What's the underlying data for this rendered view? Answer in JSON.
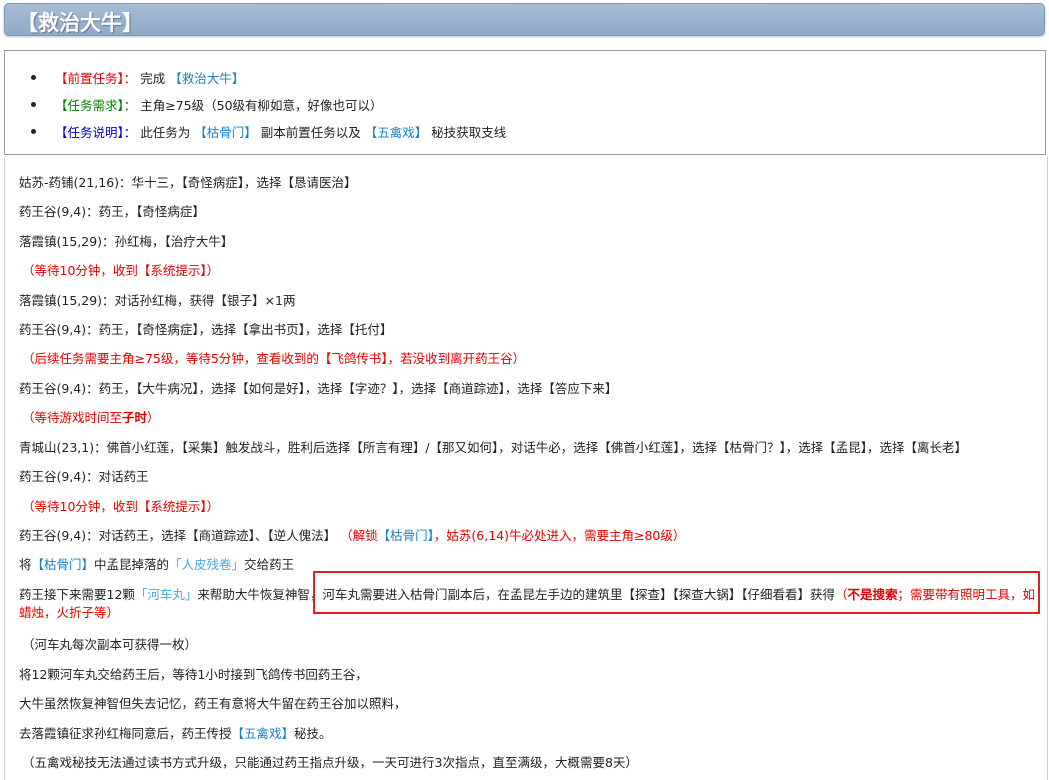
{
  "header": {
    "title": "【救治大牛】"
  },
  "info": {
    "pre_label": "【前置任务】：",
    "pre_text": "完成",
    "pre_link": "【救治大牛】",
    "req_label": "【任务需求】：",
    "req_text": "主角≥75级（50级有柳如意，好像也可以）",
    "desc_label": "【任务说明】：",
    "desc_text1": "此任务为",
    "desc_link1": "【枯骨门】",
    "desc_text2": "副本前置任务以及",
    "desc_link2": "【五禽戏】",
    "desc_text3": "秘技获取支线"
  },
  "steps": {
    "s1": "姑苏-药铺(21,16)：华十三，【奇怪病症】，选择【恳请医治】",
    "s2": "药王谷(9,4)：药王，【奇怪病症】",
    "s3": "落霞镇(15,29)：孙红梅，【治疗大牛】",
    "n1": "（等待10分钟，收到【系统提示】）",
    "s4": "落霞镇(15,29)：对话孙红梅，获得【银子】×1两",
    "s5": "药王谷(9,4)：药王，【奇怪病症】，选择【拿出书页】，选择【托付】",
    "n2a": "（后续任务需要主角≥75级，等待5分钟，查看收到的",
    "n2b": "【飞鸽传书】",
    "n2c": "，若没收到离开药王谷）",
    "s6": "药王谷(9,4)：药王，【大牛病况】，选择【如何是好】，选择【字迹？】，选择【商道踪迹】，选择【答应下来】",
    "n3a": "（等待游戏时间至",
    "n3b": "子时",
    "n3c": "）",
    "s7": "青城山(23,1)：佛首小红莲，【采集】触发战斗，胜利后选择【所言有理】/【那又如何】，对话牛必，选择【佛首小红莲】，选择【枯骨门？】，选择【孟昆】，选择【离长老】",
    "s8": "药王谷(9,4)：对话药王",
    "n4": "（等待10分钟，收到【系统提示】）",
    "s9": "药王谷(9,4)：对话药王，选择【商道踪迹】、【逆人傀法】",
    "n5a": "（解锁",
    "n5b": "【枯骨门】",
    "n5c": "，姑苏(6,14)牛必处进入，需要主角≥80级）",
    "s10a": "将",
    "s10b": "【枯骨门】",
    "s10c": "中孟昆掉落的",
    "s10d": "「人皮残卷」",
    "s10e": "交给药王",
    "s11a": "药王接下来需要12颗",
    "s11b": "「河车丸」",
    "s11c": "来帮助大牛恢复神智",
    "s11d": "，河车丸需要进入枯骨门副本后，在孟昆左手边的建筑里【探查】【探查大锅】【仔细看看】获得",
    "s11e": "（",
    "s11f": "不是搜索",
    "s11g": "；需要带有照明工具，如蜡烛，火折子等）",
    "s12": "（河车丸每次副本可获得一枚）",
    "s13": "将12颗河车丸交给药王后，等待1小时接到飞鸽传书回药王谷，",
    "s14": "大牛虽然恢复神智但失去记忆，药王有意将大牛留在药王谷加以照料，",
    "s15a": "去落霞镇征求孙红梅同意后，药王传授",
    "s15b": "【五禽戏】",
    "s15c": "秘技。",
    "s16": "（五禽戏秘技无法通过读书方式升级，只能通过药王指点升级，一天可进行3次指点，直至满级，大概需要8天）"
  }
}
